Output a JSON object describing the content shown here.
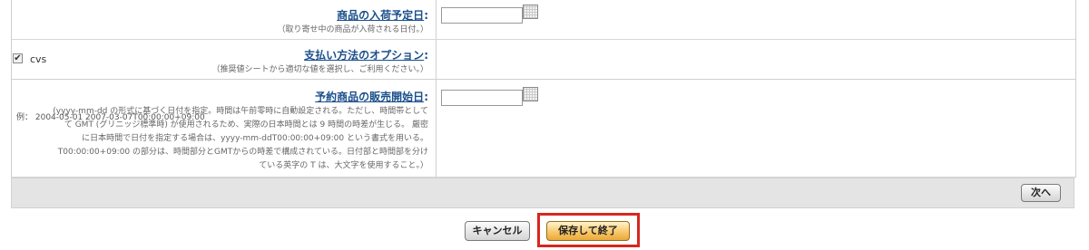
{
  "rows": {
    "arrival_date": {
      "title": "商品の入荷予定日",
      "colon": ":",
      "help": "（取り寄せ中の商品が入荷される日付。）"
    },
    "payment_options": {
      "title": "支払い方法のオプション",
      "colon": ":",
      "help": "（推奨値シートから適切な値を選択し、ご利用ください。）",
      "option_label": "cvs",
      "option_checked": true
    },
    "preorder_release_date": {
      "title": "予約商品の販売開始日",
      "colon": ":",
      "help_lines": [
        "(yyyy-mm-dd の形式に基づく日付を指定。時間は午前零時に自動設定される。ただし、時間帯として",
        "て GMT (グリニッジ標準時) が使用されるため、実際の日本時間とは 9 時間の時差が生じる。 厳密",
        "に日本時間で日付を指定する場合は、yyyy-mm-ddT00:00:00+09:00 という書式を用いる。",
        "T00:00:00+09:00 の部分は、時間部分とGMTからの時差で構成されている。日付部と時間部を分け",
        "ている英字の T は、大文字を使用すること。）"
      ],
      "example": "例： 2004-05-01 2007-03-07T00:00:00+09:00"
    }
  },
  "buttons": {
    "next": "次へ",
    "cancel": "キャンセル",
    "save_and_finish": "保存して終了"
  },
  "highlight_color": "#d7261f"
}
